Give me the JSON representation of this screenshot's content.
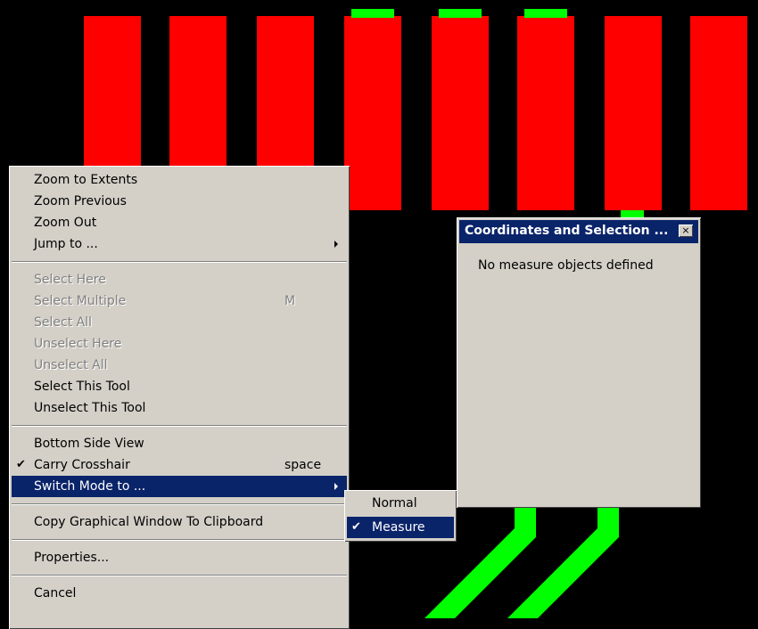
{
  "colors": {
    "pad": "#ff0000",
    "trace": "#00ff00",
    "background": "#000000",
    "menu_bg": "#d4d0c8",
    "highlight": "#0a246a",
    "disabled_text": "#808080"
  },
  "context_menu": {
    "groups": [
      [
        {
          "label": "Zoom to Extents",
          "enabled": true
        },
        {
          "label": "Zoom Previous",
          "enabled": true
        },
        {
          "label": "Zoom Out",
          "enabled": true
        },
        {
          "label": "Jump to ...",
          "enabled": true,
          "submenu": true
        }
      ],
      [
        {
          "label": "Select Here",
          "enabled": false
        },
        {
          "label": "Select Multiple",
          "enabled": false,
          "shortcut": "M"
        },
        {
          "label": "Select All",
          "enabled": false
        },
        {
          "label": "Unselect Here",
          "enabled": false
        },
        {
          "label": "Unselect All",
          "enabled": false
        },
        {
          "label": "Select This Tool",
          "enabled": true
        },
        {
          "label": "Unselect This Tool",
          "enabled": true
        }
      ],
      [
        {
          "label": "Bottom Side View",
          "enabled": true
        },
        {
          "label": "Carry Crosshair",
          "enabled": true,
          "checked": true,
          "shortcut": "space"
        },
        {
          "label": "Switch Mode to ...",
          "enabled": true,
          "submenu": true,
          "highlighted": true
        }
      ],
      [
        {
          "label": "Copy Graphical Window To Clipboard",
          "enabled": true
        }
      ],
      [
        {
          "label": "Properties...",
          "enabled": true
        }
      ],
      [
        {
          "label": "Cancel",
          "enabled": true
        }
      ]
    ]
  },
  "submenu": {
    "items": [
      {
        "label": "Normal",
        "checked": false,
        "highlighted": false
      },
      {
        "label": "Measure",
        "checked": true,
        "highlighted": true
      }
    ]
  },
  "panel": {
    "title": "Coordinates and Selection ...",
    "close_glyph": "×",
    "message": "No measure objects defined"
  },
  "check_glyph": "✔"
}
